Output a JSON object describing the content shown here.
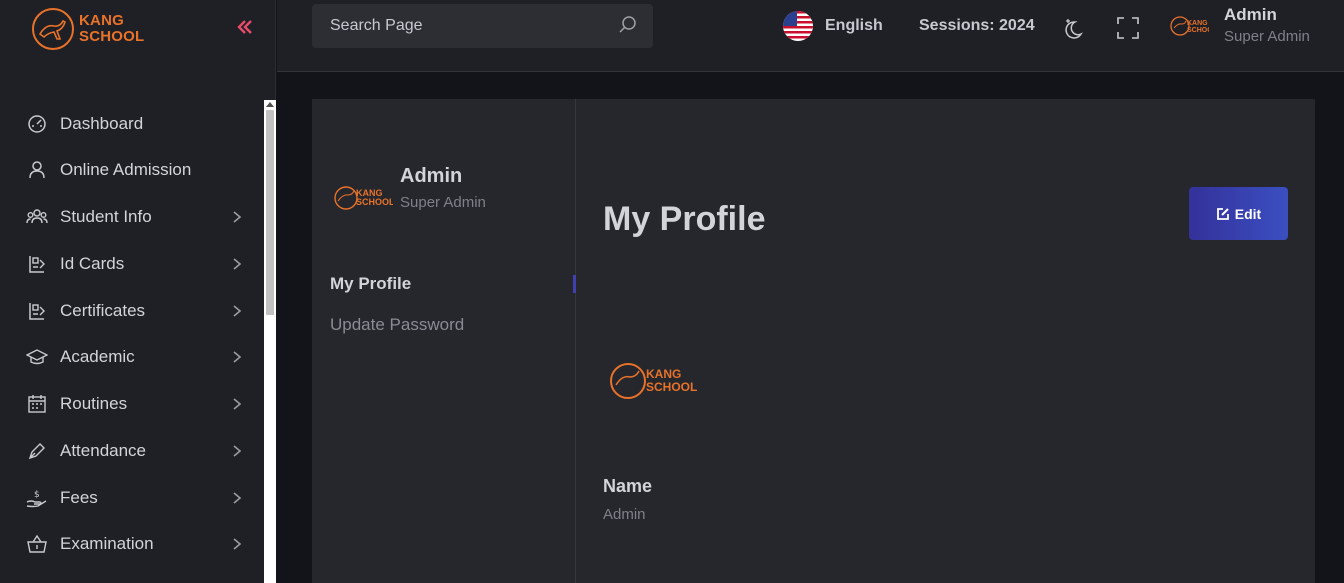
{
  "brand": {
    "name_line1": "KANG",
    "name_line2": "SCHOOL",
    "accent": "#e8722a"
  },
  "sidebar": {
    "collapse_icon": "double-chevron-left-icon",
    "items": [
      {
        "label": "Dashboard",
        "icon": "gauge-icon",
        "has_children": false
      },
      {
        "label": "Online Admission",
        "icon": "user-icon",
        "has_children": false
      },
      {
        "label": "Student Info",
        "icon": "users-group-icon",
        "has_children": true
      },
      {
        "label": "Id Cards",
        "icon": "id-card-icon",
        "has_children": true
      },
      {
        "label": "Certificates",
        "icon": "certificate-icon",
        "has_children": true
      },
      {
        "label": "Academic",
        "icon": "graduation-cap-icon",
        "has_children": true
      },
      {
        "label": "Routines",
        "icon": "calendar-icon",
        "has_children": true
      },
      {
        "label": "Attendance",
        "icon": "pen-icon",
        "has_children": true
      },
      {
        "label": "Fees",
        "icon": "money-hand-icon",
        "has_children": true
      },
      {
        "label": "Examination",
        "icon": "basket-icon",
        "has_children": true
      }
    ]
  },
  "header": {
    "search_placeholder": "Search Page",
    "language": "English",
    "sessions": "Sessions: 2024",
    "user_name": "Admin",
    "user_role": "Super Admin"
  },
  "profile_sidebar": {
    "name": "Admin",
    "role": "Super Admin",
    "menu": {
      "my_profile": "My Profile",
      "update_password": "Update Password"
    }
  },
  "main": {
    "title": "My Profile",
    "edit_label": "Edit",
    "fields": [
      {
        "label": "Name",
        "value": "Admin"
      }
    ]
  }
}
